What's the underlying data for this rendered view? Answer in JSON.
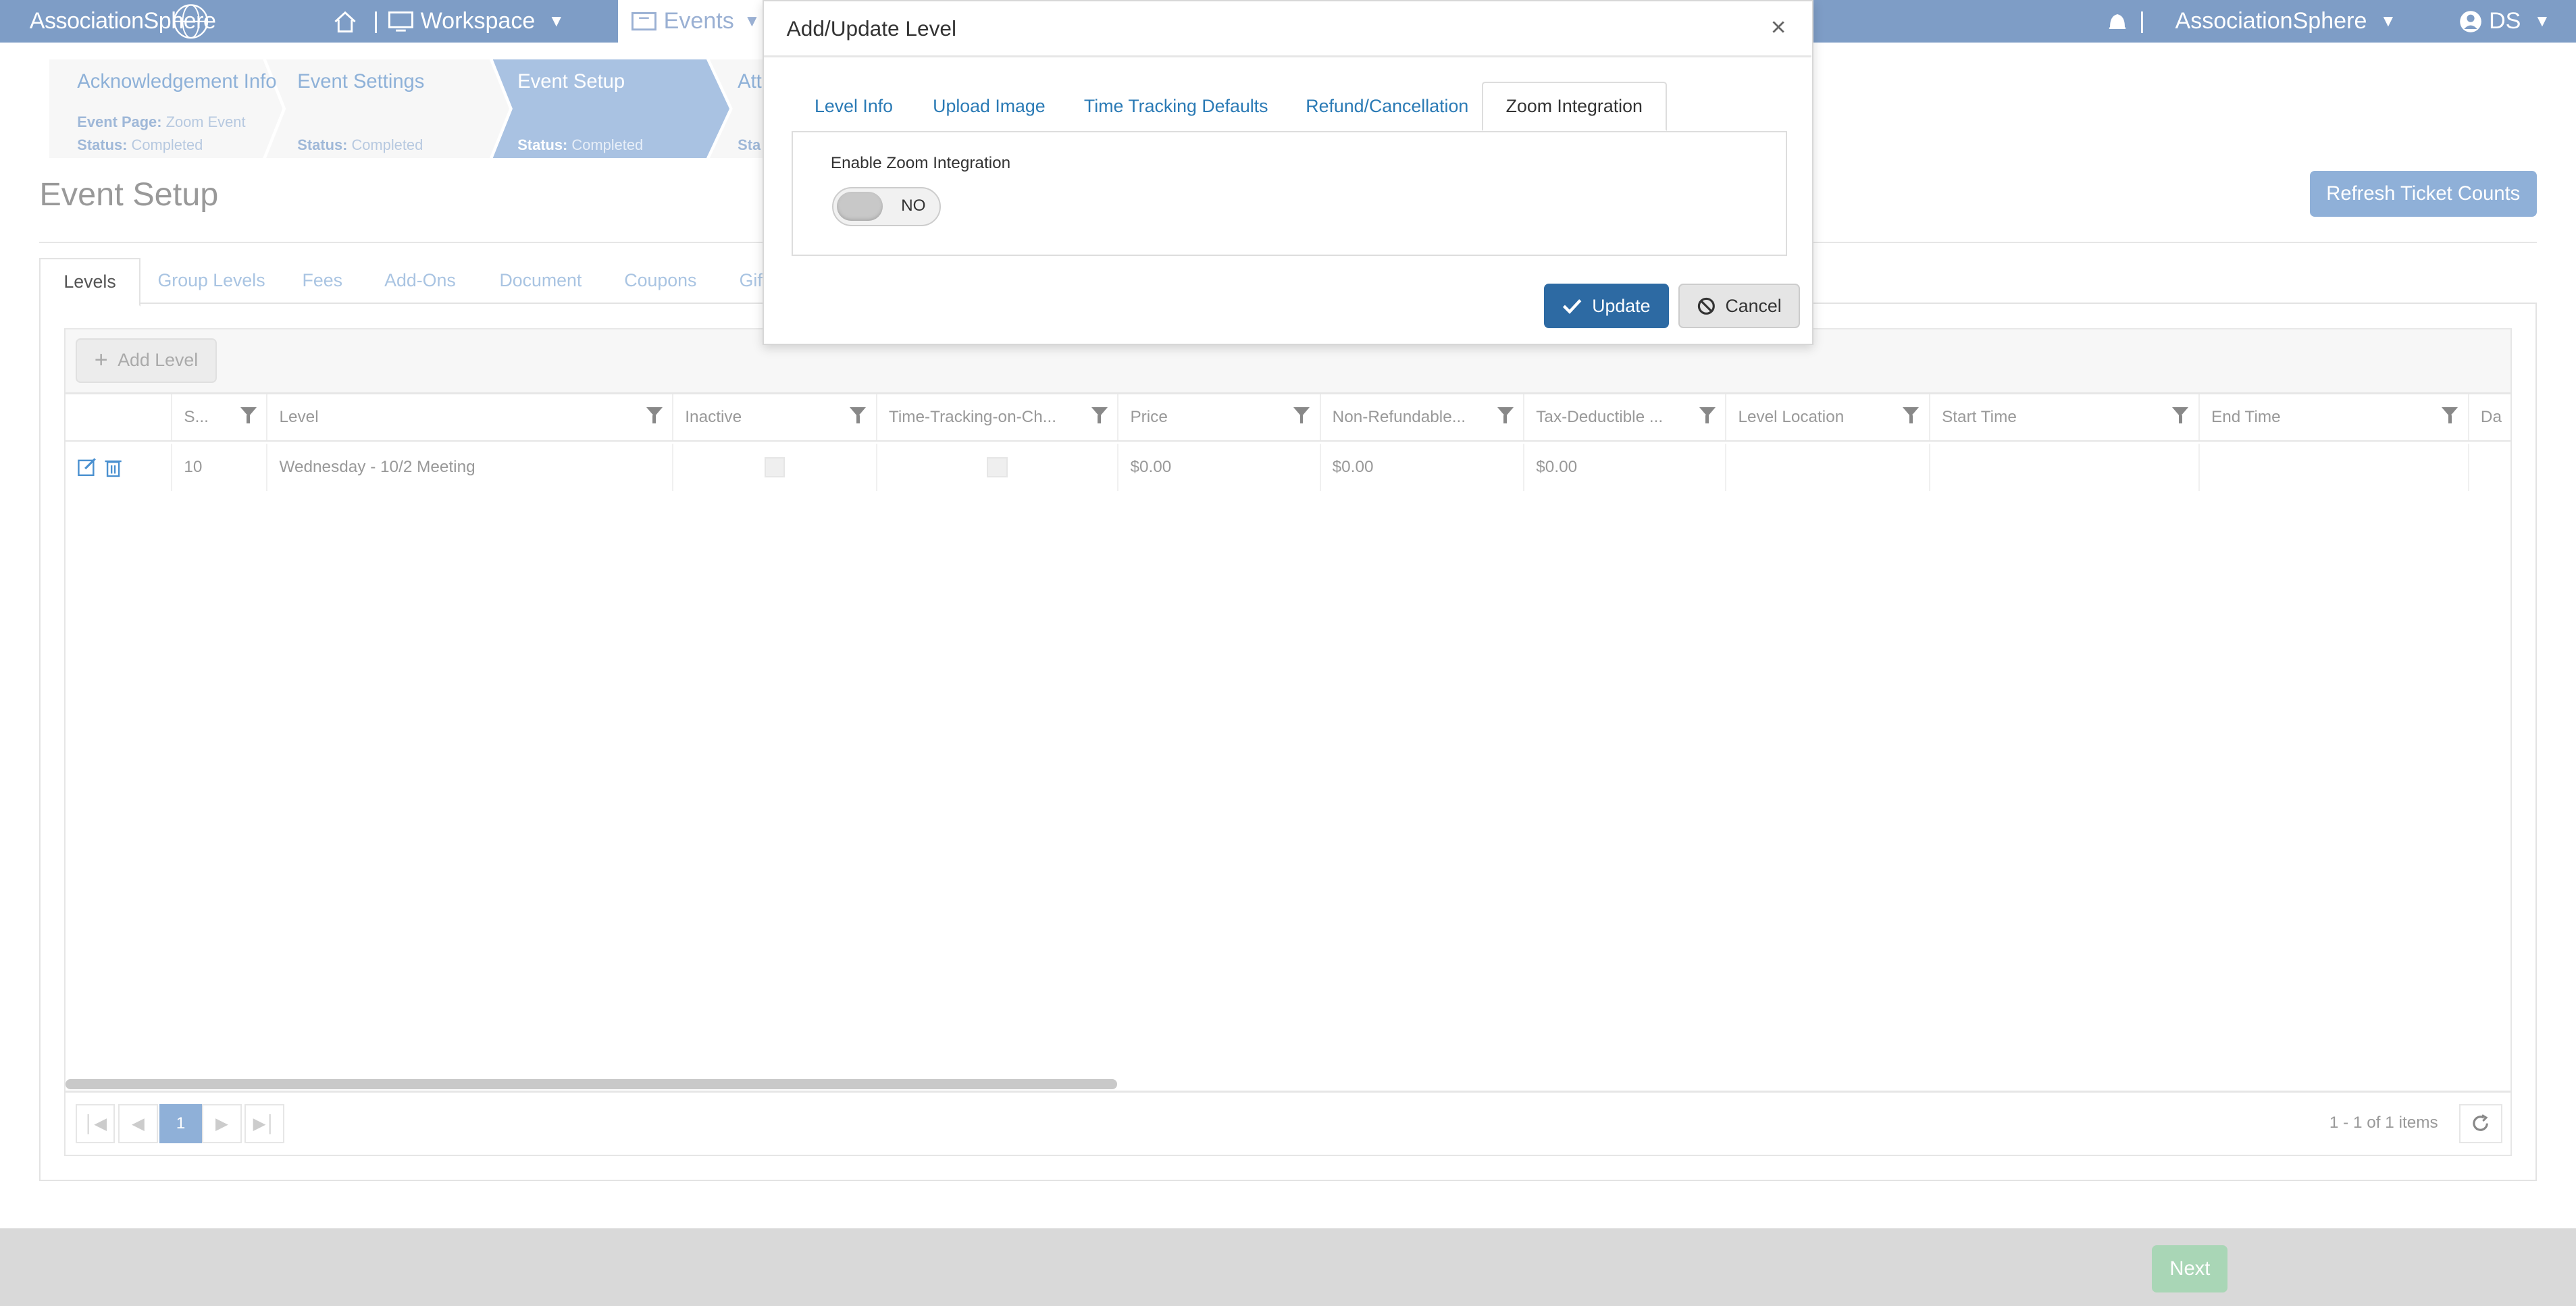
{
  "topnav": {
    "logo": "AssociationSphere",
    "workspace": "Workspace",
    "events": "Events",
    "org": "AssociationSphere",
    "user": "DS",
    "separator": "|"
  },
  "steps": [
    {
      "title": "Acknowledgement Info",
      "line1_label": "Event Page:",
      "line1_value": "Zoom Event",
      "status_label": "Status:",
      "status_value": "Completed"
    },
    {
      "title": "Event Settings",
      "status_label": "Status:",
      "status_value": "Completed"
    },
    {
      "title": "Event Setup",
      "status_label": "Status:",
      "status_value": "Completed"
    },
    {
      "title": "Att",
      "status_label": "Sta"
    }
  ],
  "page": {
    "title": "Event Setup",
    "refresh_button": "Refresh Ticket Counts"
  },
  "tabs": [
    "Levels",
    "Group Levels",
    "Fees",
    "Add-Ons",
    "Document",
    "Coupons",
    "Gif"
  ],
  "grid": {
    "add_button": "Add Level",
    "columns": [
      "S...",
      "Level",
      "Inactive",
      "Time-Tracking-on-Ch...",
      "Price",
      "Non-Refundable...",
      "Tax-Deductible ...",
      "Level Location",
      "Start Time",
      "End Time",
      "Da"
    ],
    "rows": [
      {
        "seq": "10",
        "level": "Wednesday - 10/2 Meeting",
        "price": "$0.00",
        "non_refundable": "$0.00",
        "tax_deductible": "$0.00"
      }
    ],
    "pager": {
      "current_page": "1",
      "summary": "1 - 1 of 1 items"
    }
  },
  "footer": {
    "next": "Next"
  },
  "modal": {
    "title": "Add/Update Level",
    "close": "×",
    "tabs": [
      "Level Info",
      "Upload Image",
      "Time Tracking Defaults",
      "Refund/Cancellation",
      "Zoom Integration"
    ],
    "active_tab": "Zoom Integration",
    "field_label": "Enable Zoom Integration",
    "toggle_value": "NO",
    "update": "Update",
    "cancel": "Cancel"
  },
  "colors": {
    "nav": "#7e9dc6",
    "primary": "#2d6aa3",
    "accent_light": "#8fb0d8",
    "next": "#a9d6b6"
  }
}
